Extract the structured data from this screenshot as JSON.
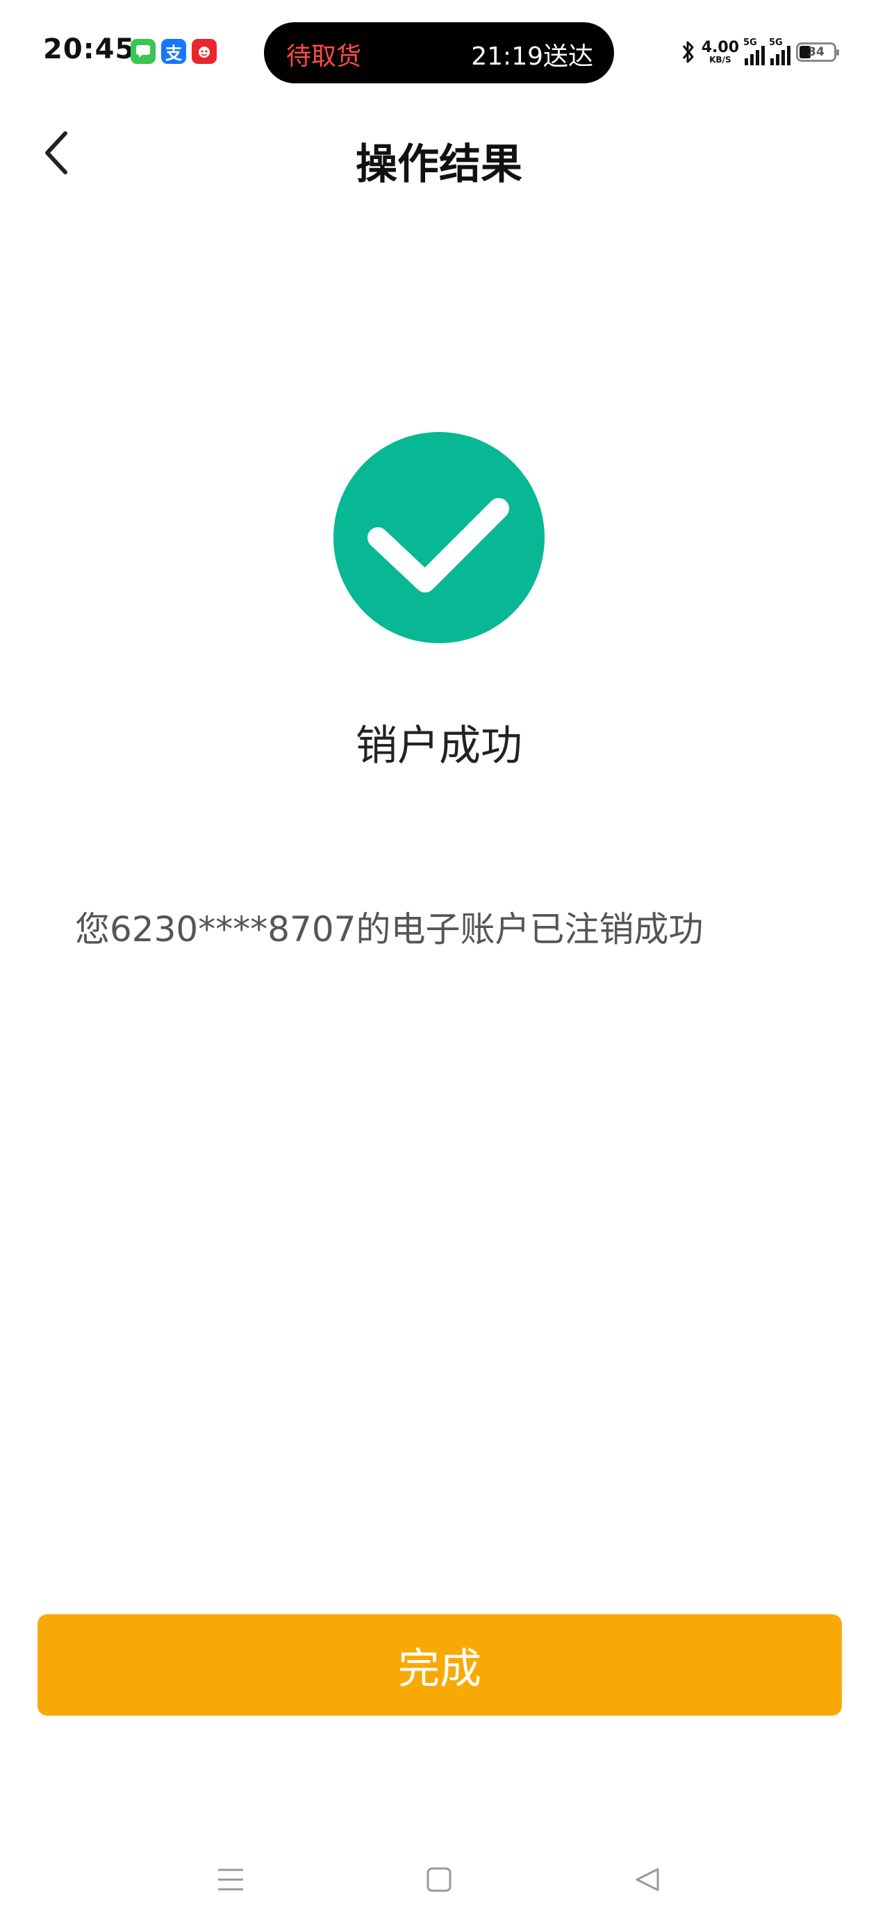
{
  "status_bar": {
    "time": "20:45",
    "notification_icons": [
      "message-icon",
      "alipay-icon",
      "shopping-app-icon"
    ],
    "alipay_glyph": "支",
    "pill_left": "待取货",
    "pill_right": "21:19送达",
    "net_speed_value": "4.00",
    "net_speed_unit": "KB/S",
    "signal_1_label": "5G",
    "signal_2_label": "5G",
    "battery_level": "34"
  },
  "header": {
    "title": "操作结果"
  },
  "result": {
    "status": "销户成功",
    "message": "您6230****8707的电子账户已注销成功",
    "icon_color": "#08b894"
  },
  "actions": {
    "done_label": "完成",
    "done_color": "#f9a906"
  },
  "system_nav": {
    "items": [
      "menu-icon",
      "home-icon",
      "back-triangle-icon"
    ]
  }
}
